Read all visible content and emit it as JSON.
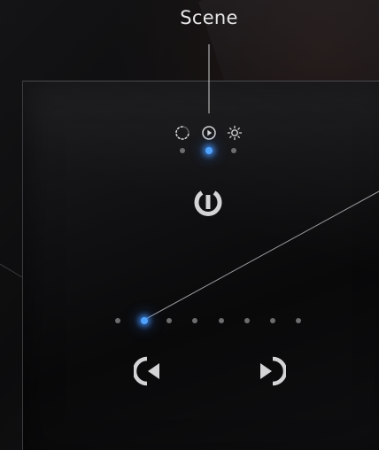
{
  "callout": {
    "title": "Scene"
  },
  "modes": [
    {
      "icon": "loading-spinner-icon",
      "active": false
    },
    {
      "icon": "play-circle-icon",
      "active": true
    },
    {
      "icon": "sun-brightness-icon",
      "active": false
    }
  ],
  "mode_indicator_active_index": 1,
  "power": {
    "icon": "power-icon"
  },
  "scene_indicator": {
    "count": 8,
    "active_index": 1
  },
  "navigation": {
    "previous": {
      "icon": "previous-arrow-icon"
    },
    "next": {
      "icon": "next-arrow-icon"
    }
  },
  "colors": {
    "accent": "#4fa3ff",
    "icon": "#d4d4d6",
    "inactive_dot": "#6d6d70",
    "callout_line": "#cfcfcf"
  }
}
